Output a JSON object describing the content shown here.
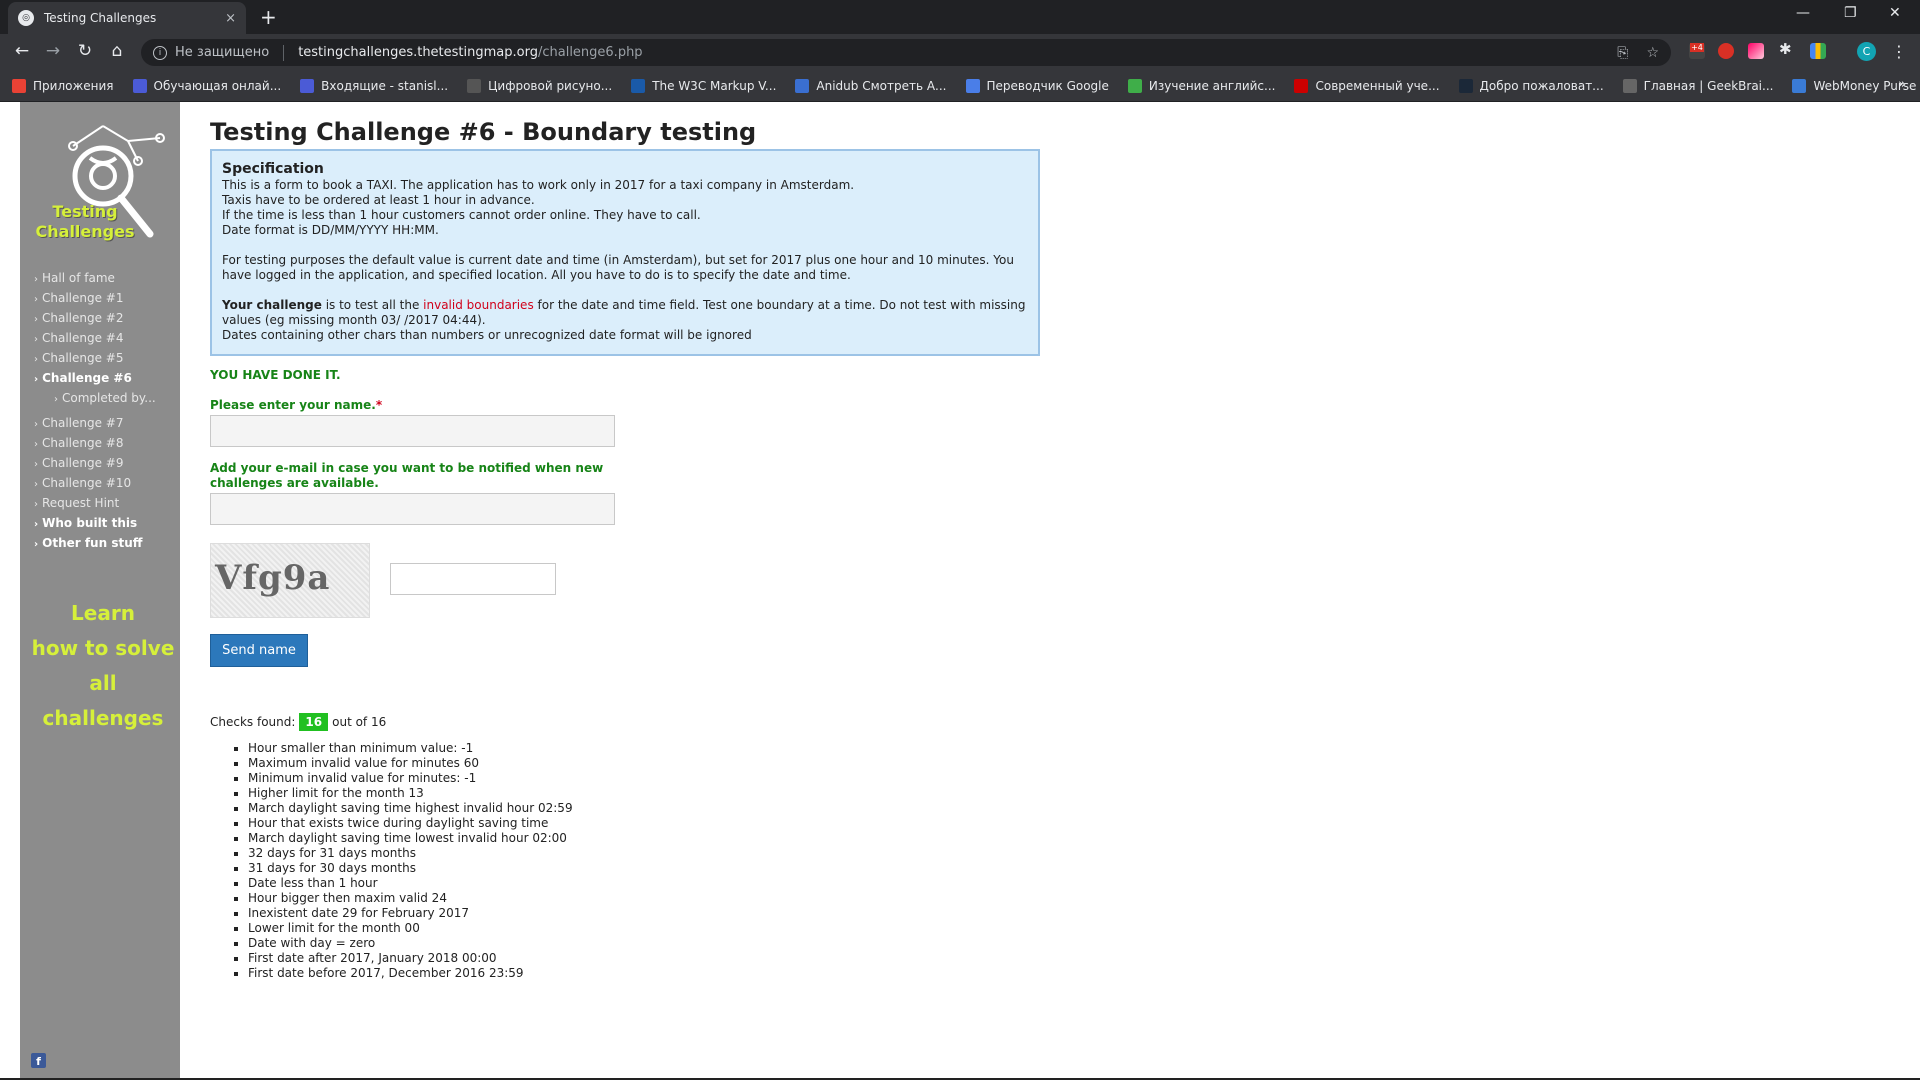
{
  "browser": {
    "tab_title": "Testing Challenges",
    "tab_close": "×",
    "new_tab": "+",
    "window_controls": [
      "—",
      "❐",
      "✕"
    ],
    "url_security": "Не защищено",
    "url_host": "testingchallenges.thetestingmap.org",
    "url_path": "/challenge6.php",
    "profile_initial": "C",
    "extension_badge": "+4",
    "bookmarks": [
      {
        "label": "Приложения",
        "icon": "apps-grid-icon",
        "color": "#e94235"
      },
      {
        "label": "Обучающая онлай...",
        "icon": "s-icon",
        "color": "#4b5bd6"
      },
      {
        "label": "Входящие - stanisl...",
        "icon": "mail-icon",
        "color": "#4b5bd6"
      },
      {
        "label": "Цифровой рисуно...",
        "icon": "folder-icon",
        "color": "#555"
      },
      {
        "label": "The W3C Markup V...",
        "icon": "w3c-icon",
        "color": "#1a5aa8"
      },
      {
        "label": "Anidub Смотреть А...",
        "icon": "anidub-icon",
        "color": "#3a6fd1"
      },
      {
        "label": "Переводчик Google",
        "icon": "translate-icon",
        "color": "#4a7ee8"
      },
      {
        "label": "Изучение английс...",
        "icon": "ed-icon",
        "color": "#3fae49"
      },
      {
        "label": "Современный уче...",
        "icon": "x-red-icon",
        "color": "#c00"
      },
      {
        "label": "Добро пожаловат...",
        "icon": "steam-icon",
        "color": "#1b2838"
      },
      {
        "label": "Главная | GeekBrai...",
        "icon": "geekbrains-icon",
        "color": "#666"
      },
      {
        "label": "WebMoney Purse »",
        "icon": "webmoney-icon",
        "color": "#3a7bd5"
      }
    ],
    "bookmarks_more": "»"
  },
  "sidebar": {
    "logo_line1": "Testing",
    "logo_line2": "Challenges",
    "items": [
      {
        "label": "Hall of fame"
      },
      {
        "label": "Challenge #1"
      },
      {
        "label": "Challenge #2"
      },
      {
        "label": "Challenge #4"
      },
      {
        "label": "Challenge #5"
      },
      {
        "label": "Challenge #6"
      },
      {
        "label": "Completed by..."
      },
      {
        "label": "Challenge #7"
      },
      {
        "label": "Challenge #8"
      },
      {
        "label": "Challenge #9"
      },
      {
        "label": "Challenge #10"
      },
      {
        "label": "Request Hint"
      },
      {
        "label": "Who built this"
      },
      {
        "label": "Other fun stuff"
      }
    ],
    "learn_line1": "Learn",
    "learn_line2": "how to solve",
    "learn_line3": "all challenges",
    "facebook": "f"
  },
  "main": {
    "title": "Testing Challenge #6 - Boundary testing",
    "spec": {
      "heading": "Specification",
      "line1": "This is a form to book a TAXI. The application has to work only in 2017 for a taxi company in Amsterdam.",
      "line2": "Taxis have to be ordered at least 1 hour in advance.",
      "line3": "If the time is less than 1 hour customers cannot order online. They have to call.",
      "line4": "Date format is DD/MM/YYYY HH:MM.",
      "para2": "For testing purposes the default value is current date and time (in Amsterdam), but set for 2017 plus one hour and 10 minutes. You have logged in the application, and specified location. All you have to do is to specify the date and time.",
      "challenge_bold": "Your challenge",
      "challenge_mid": " is to test all the ",
      "challenge_red": "invalid boundaries",
      "challenge_rest": " for the date and time field. Test one boundary at a time. Do not test with missing values (eg missing month 03/ /2017 04:44).",
      "line_last": "Dates containing other chars than numbers or unrecognized date format will be ignored"
    },
    "done_text": "YOU HAVE DONE IT.",
    "name_label": "Please enter your name.",
    "required_mark": "*",
    "email_label_1": "Add your e-mail in case you want to be notified when new",
    "email_label_2": "challenges are available.",
    "captcha_text": "Vfg9a",
    "send_button": "Send name",
    "checks_prefix": "Checks found:",
    "checks_found": "16",
    "checks_suffix": "out of 16",
    "checks": [
      "Hour smaller than minimum value: -1",
      "Maximum invalid value for minutes 60",
      "Minimum invalid value for minutes: -1",
      "Higher limit for the month 13",
      "March daylight saving time highest invalid hour 02:59",
      "Hour that exists twice during daylight saving time",
      "March daylight saving time lowest invalid hour 02:00",
      "32 days for 31 days months",
      "31 days for 30 days months",
      "Date less than 1 hour",
      "Hour bigger then maxim valid 24",
      "Inexistent date 29 for February 2017",
      "Lower limit for the month 00",
      "Date with day = zero",
      "First date after 2017, January 2018 00:00",
      "First date before 2017, December 2016 23:59"
    ]
  },
  "colors": {
    "sidebar_bg": "#8c8c8c",
    "accent_green": "#178417",
    "logo_yellow": "#d6f03a",
    "button_blue": "#2c78bb",
    "badge_green": "#21c021",
    "spec_bg": "#dbeefb"
  }
}
